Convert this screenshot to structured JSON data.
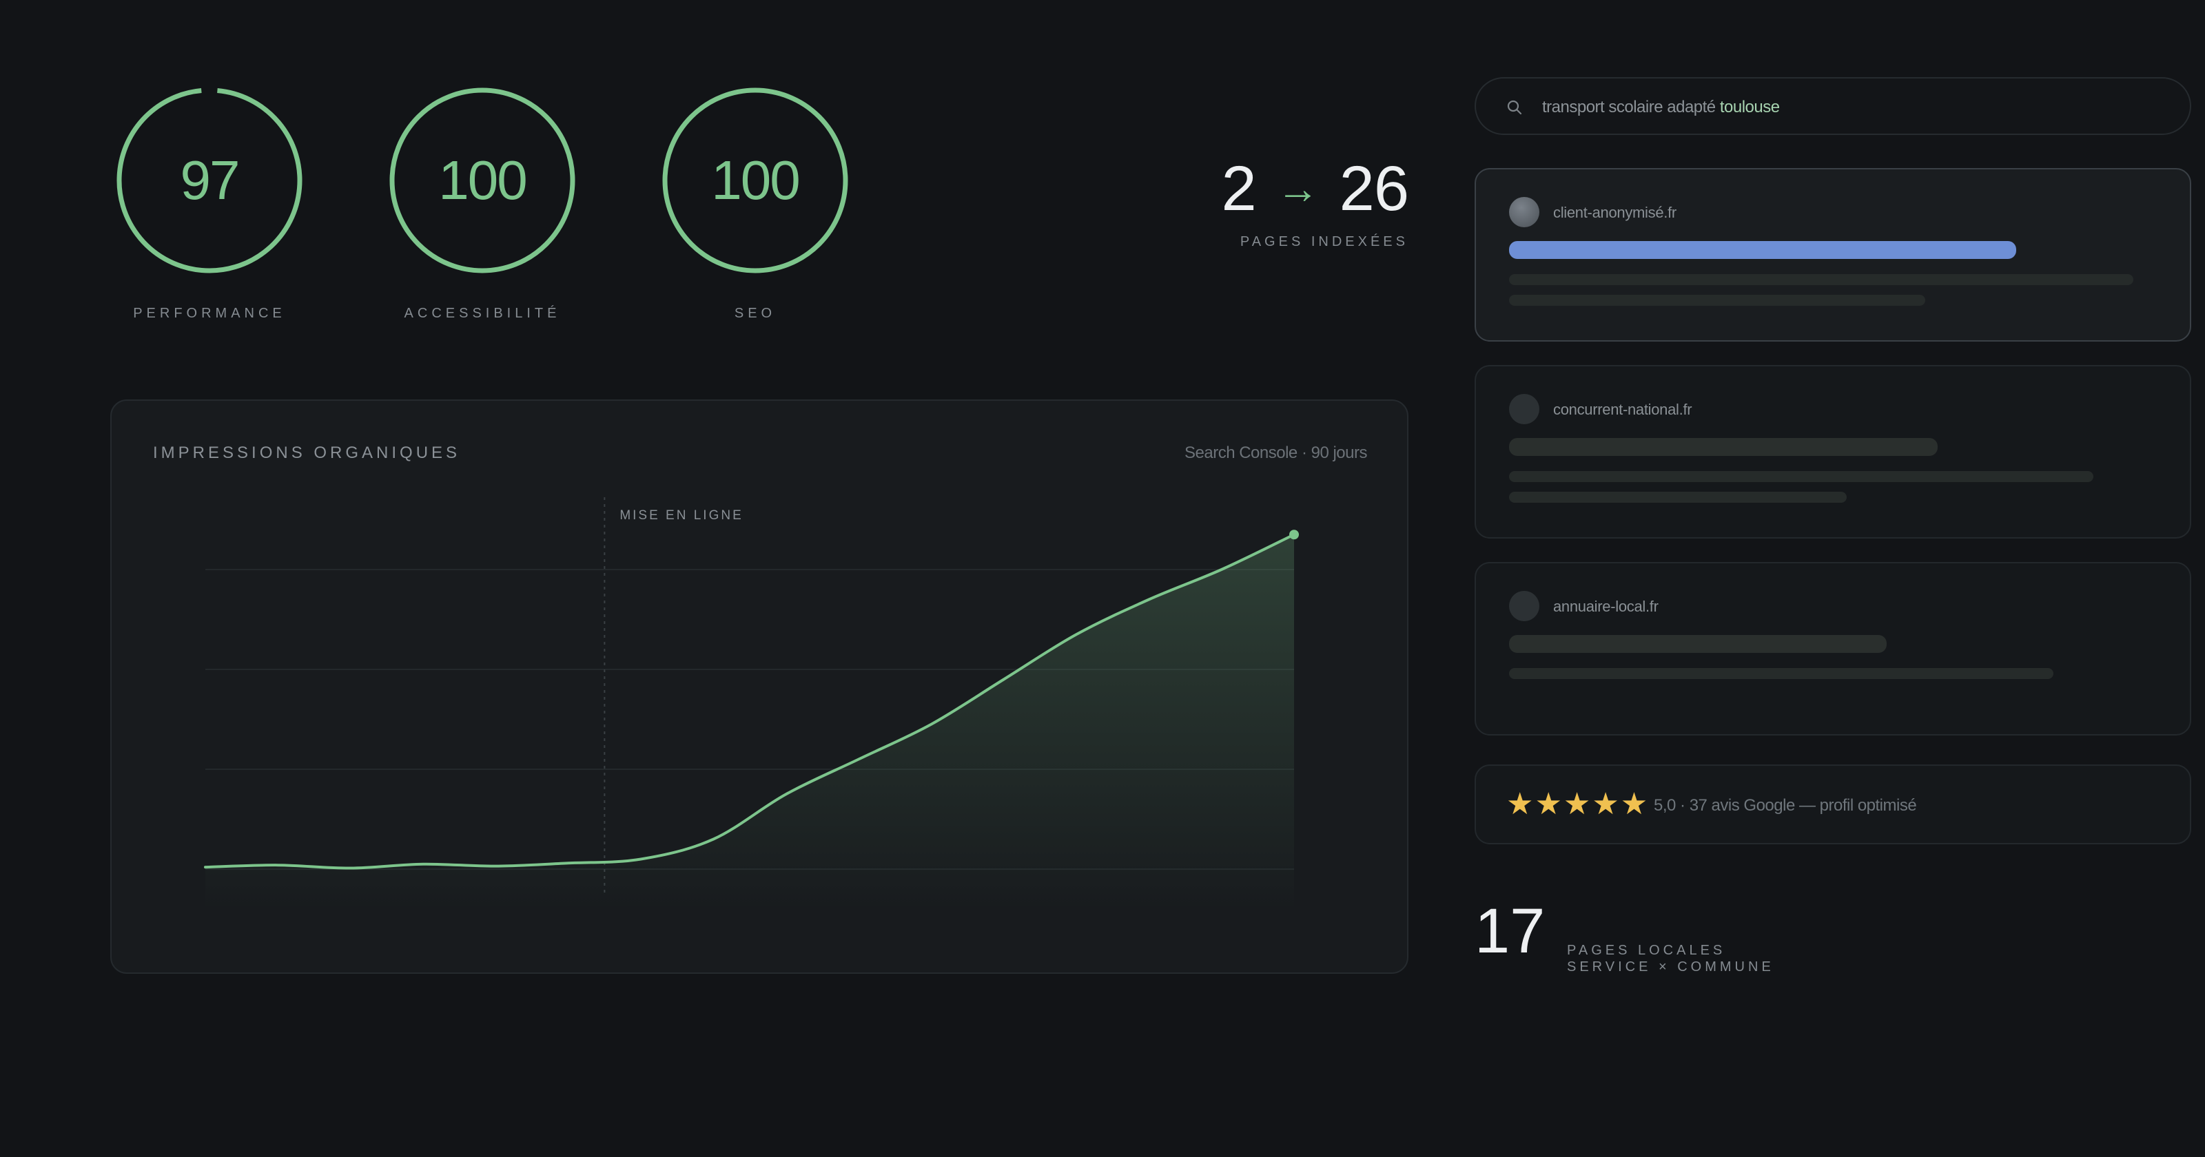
{
  "scores": [
    {
      "value": "97",
      "label": "PERFORMANCE",
      "fraction": 0.97
    },
    {
      "value": "100",
      "label": "ACCESSIBILITÉ",
      "fraction": 1.0
    },
    {
      "value": "100",
      "label": "SEO",
      "fraction": 1.0
    }
  ],
  "indexed": {
    "from": "2",
    "arrow": "→",
    "to": "26",
    "label": "PAGES INDEXÉES"
  },
  "chart": {
    "title": "IMPRESSIONS ORGANIQUES",
    "source": "Search Console · 90 jours",
    "marker_label": "MISE EN LIGNE"
  },
  "chart_data": {
    "type": "area",
    "title": "IMPRESSIONS ORGANIQUES",
    "xlabel": "",
    "ylabel": "",
    "grid": true,
    "marker": {
      "x": 5.5,
      "label": "MISE EN LIGNE"
    },
    "series": [
      {
        "x": [
          0,
          1,
          2,
          3,
          4,
          5,
          6,
          7,
          8,
          9,
          10,
          11,
          12,
          13,
          14,
          15
        ],
        "values": [
          0.2,
          0.4,
          0.1,
          0.5,
          0.3,
          0.6,
          1.0,
          3.0,
          7.5,
          11.0,
          14.5,
          19.0,
          23.5,
          27.0,
          30.0,
          33.5
        ]
      }
    ],
    "xlim": [
      0,
      15
    ],
    "ylim": [
      0,
      40
    ],
    "color": "#7dc58c"
  },
  "search": {
    "query_prefix": "transport scolaire adapté ",
    "query_highlight": "toulouse"
  },
  "results": [
    {
      "domain": "client-anonymisé.fr",
      "active": true
    },
    {
      "domain": "concurrent-national.fr",
      "active": false
    },
    {
      "domain": "annuaire-local.fr",
      "active": false
    }
  ],
  "rating": {
    "stars": "★★★★★",
    "text": "5,0 · 37 avis Google — profil optimisé",
    "value": 5
  },
  "local_pages": {
    "count": "17",
    "label_line1": "PAGES LOCALES",
    "label_line2": "SERVICE × COMMUNE"
  },
  "colors": {
    "accent": "#7dc58c",
    "blue": "#6e8fd6",
    "star": "#f0c050",
    "background": "#121417"
  }
}
